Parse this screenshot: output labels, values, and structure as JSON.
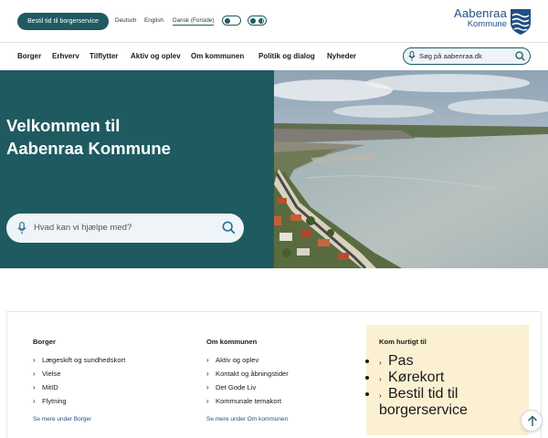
{
  "topbar": {
    "booking_button": "Bestil tid til borgerservice",
    "languages": [
      "Deutsch",
      "English",
      "Dansk (Forside)"
    ]
  },
  "logo": {
    "name": "Aabenraa",
    "sub": "Kommune"
  },
  "nav": {
    "items": [
      "Borger",
      "Erhverv",
      "Tilflytter",
      "Aktiv og oplev",
      "Om kommunen",
      "Politik og dialog",
      "Nyheder"
    ],
    "search_placeholder": "Søg på aabenraa.dk"
  },
  "hero": {
    "title_line1": "Velkommen til",
    "title_line2": "Aabenraa Kommune",
    "search_placeholder": "Hvad kan vi hjælpe med?"
  },
  "links": {
    "borger": {
      "title": "Borger",
      "items": [
        "Lægeskift og sundhedskort",
        "Vielse",
        "MitID",
        "Flytning"
      ],
      "more": "Se mere under Borger"
    },
    "om": {
      "title": "Om kommunen",
      "items": [
        "Aktiv og oplev",
        "Kontakt og åbningstider",
        "Det Gode Liv",
        "Kommunale temakort"
      ],
      "more": "Se mere under Om kommunen"
    },
    "quick": {
      "title": "Kom hurtigt til",
      "items": [
        "Pas",
        "Kørekort",
        "Bestil tid til borgerservice"
      ]
    }
  },
  "colors": {
    "brand_teal": "#1f5a61",
    "logo_blue": "#1f4f84",
    "quick_bg": "#fbf0d2",
    "search_bg": "#eef4f8"
  },
  "icons": [
    "microphone-icon",
    "search-icon",
    "chevron-right-icon",
    "arrow-up-icon",
    "toggle-icon",
    "contrast-icon",
    "coat-of-arms-icon"
  ]
}
